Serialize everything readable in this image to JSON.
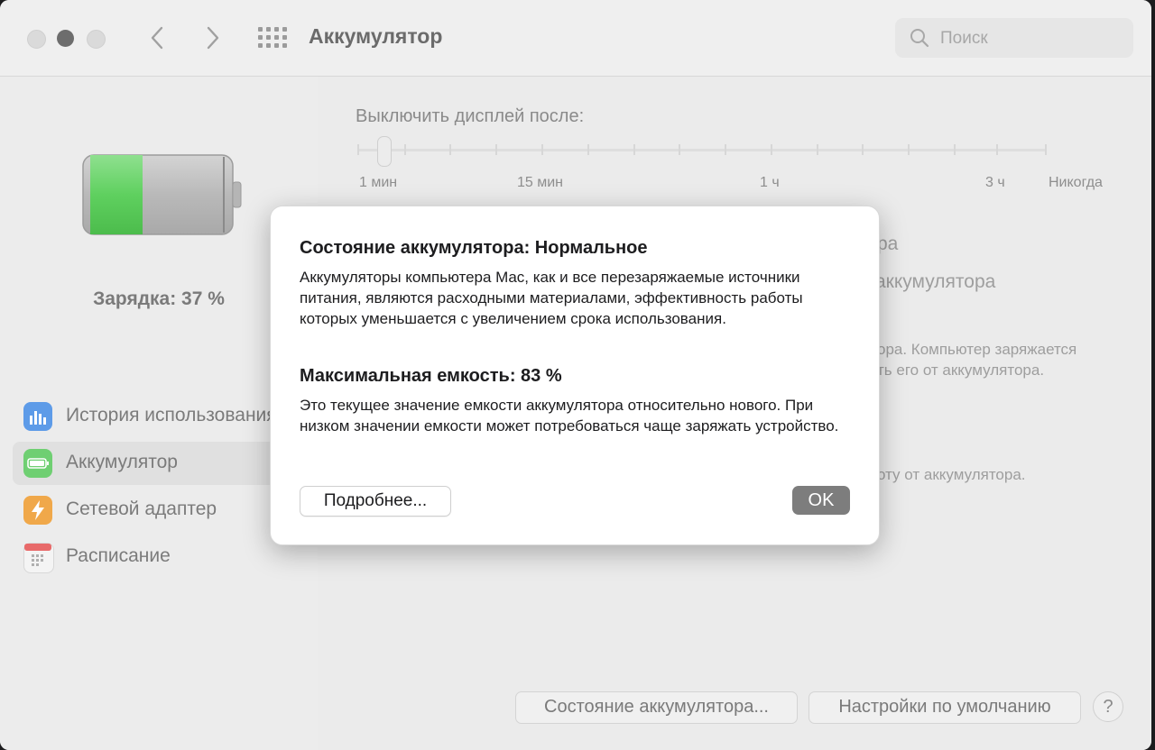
{
  "window": {
    "title": "Аккумулятор"
  },
  "toolbar": {
    "back_icon": "chevron-left-icon",
    "forward_icon": "chevron-right-icon",
    "grid_icon": "show-all-grid-icon"
  },
  "search": {
    "placeholder": "Поиск"
  },
  "battery": {
    "charge_label": "Зарядка: 37 %",
    "level_fraction": 0.37,
    "fill_color": "#5fd05f"
  },
  "sidebar": {
    "items": [
      {
        "label": "История использования",
        "icon": "chart-icon",
        "icon_color": "#4a90e2",
        "selected": false
      },
      {
        "label": "Аккумулятор",
        "icon": "battery-icon",
        "icon_color": "#4cd964",
        "selected": true
      },
      {
        "label": "Сетевой адаптер",
        "icon": "lightning-icon",
        "icon_color": "#f5a623",
        "selected": false
      },
      {
        "label": "Расписание",
        "icon": "calendar-icon",
        "icon_color": "#f0f0f0",
        "selected": false
      }
    ]
  },
  "display_off": {
    "label": "Выключить дисплей после:",
    "tick_labels": [
      "1 мин",
      "15 мин",
      "1 ч",
      "3 ч",
      "Никогда"
    ],
    "value": "1 мин"
  },
  "background_text": {
    "line1": "ра",
    "line2": "аккумулятора",
    "line3": "ора. Компьютер заряжается",
    "line4": "ть его от аккумулятора.",
    "line5": "оту от аккумулятора."
  },
  "bottom_buttons": {
    "battery_health": "Состояние аккумулятора...",
    "restore_defaults": "Настройки по умолчанию",
    "help": "?"
  },
  "dialog": {
    "heading1": "Состояние аккумулятора: Нормальное",
    "text1": "Аккумуляторы компьютера Mac, как и все перезаряжаемые источники питания, являются расходными материалами, эффективность работы которых уменьшается с увеличением срока использования.",
    "heading2": "Максимальная емкость: 83 %",
    "text2": "Это текущее значение емкости аккумулятора относительно нового. При низком значении емкости может потребоваться чаще заряжать устройство.",
    "more_button": "Подробнее...",
    "ok_button": "OK"
  }
}
